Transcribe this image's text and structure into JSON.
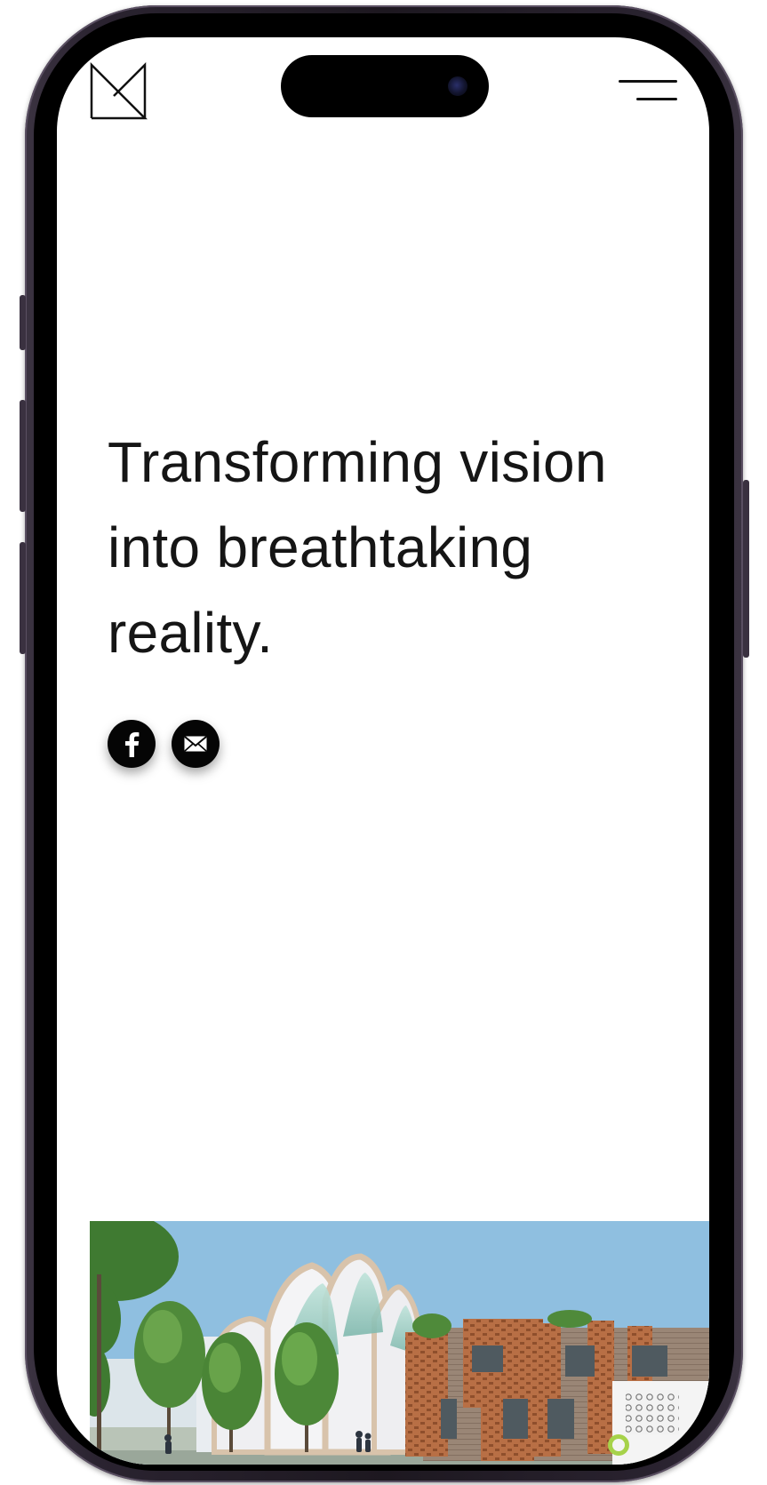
{
  "hero": {
    "lines": [
      "Transforming vision",
      "into breathtaking",
      "reality."
    ]
  },
  "header": {
    "logo_icon": "monogram-logo-icon",
    "menu_icon": "hamburger-menu-icon"
  },
  "social": [
    {
      "icon": "facebook-icon"
    },
    {
      "icon": "email-icon"
    }
  ],
  "colors": {
    "text": "#151515",
    "social_bg": "#050505",
    "sky": "#8fbfe0",
    "brick": "#b86f45"
  }
}
